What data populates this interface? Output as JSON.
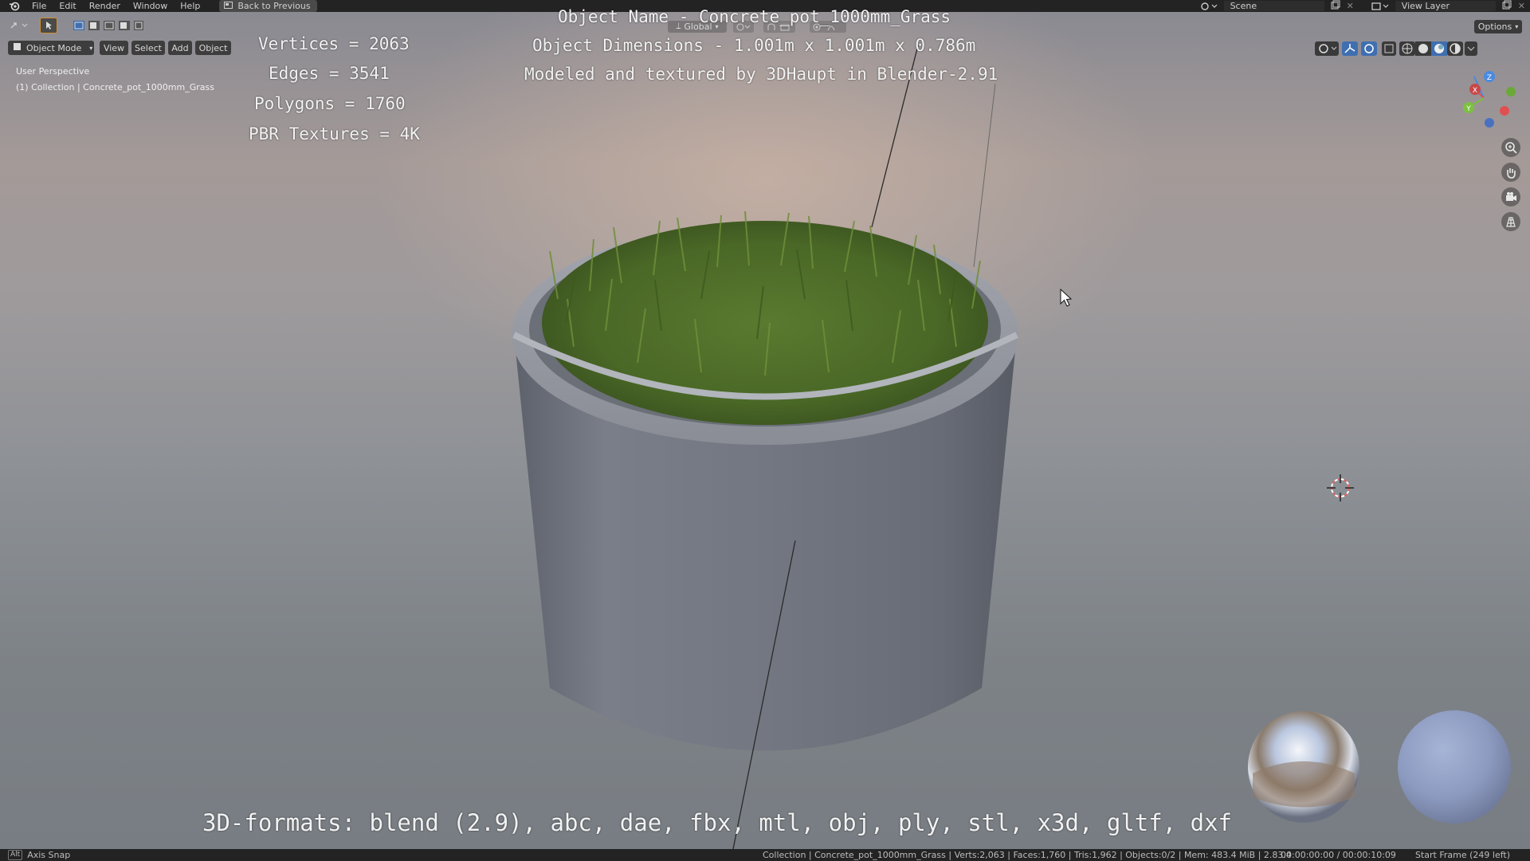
{
  "menubar": {
    "items": [
      "File",
      "Edit",
      "Render",
      "Window",
      "Help"
    ],
    "back_button": "Back to Previous",
    "scene": "Scene",
    "view_layer": "View Layer"
  },
  "toolbar": {
    "orientation": "Global",
    "options": "Options"
  },
  "viewport_header": {
    "mode": "Object Mode",
    "view": "View",
    "select": "Select",
    "add": "Add",
    "object": "Object"
  },
  "viewport_info": {
    "perspective": "User Perspective",
    "collection": "(1) Collection | Concrete_pot_1000mm_Grass"
  },
  "overlay": {
    "object_name": "Object Name - Concrete_pot_1000mm_Grass",
    "vertices": "Vertices = 2063",
    "edges": "Edges = 3541",
    "polygons": "Polygons = 1760",
    "textures": "PBR Textures = 4K",
    "dimensions": "Object Dimensions -  1.001m x 1.001m x 0.786m",
    "modeled_by": "Modeled and textured by 3DHaupt in Blender-2.91",
    "formats": "3D-formats: blend (2.9), abc, dae, fbx, mtl, obj, ply, stl, x3d, gltf, dxf"
  },
  "statusbar": {
    "key": "Alt",
    "action": "Axis Snap",
    "stats": "Collection | Concrete_pot_1000mm_Grass | Verts:2,063 | Faces:1,760 | Tris:1,962 | Objects:0/2 | Mem: 483.4 MiB | 2.83.4",
    "time": "00:00:00:00 / 00:00:10:09",
    "frame": "Start Frame (249 left)"
  },
  "colors": {
    "pot": "#6f737d",
    "grass": "#4e6d2a",
    "gizmo_x": "#e05050",
    "gizmo_y": "#7cc040",
    "gizmo_z": "#4a8ae0"
  }
}
